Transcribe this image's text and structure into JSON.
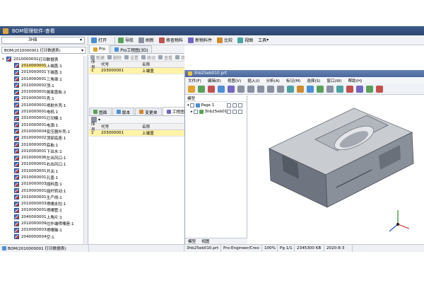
{
  "app": {
    "title": "BOM管理软件-查看",
    "colors": {
      "titlebar": "#34507e",
      "selection": "#ffe98a",
      "highlight_row": "#fff3a8"
    }
  },
  "toolbar": {
    "combo_value": "3HB",
    "items": [
      {
        "label": "打开",
        "icon": "open-icon"
      },
      {
        "label": "导航",
        "icon": "navigate-icon"
      },
      {
        "label": "刷新",
        "icon": "refresh-icon"
      },
      {
        "label": "移查物料",
        "icon": "search-material-icon"
      },
      {
        "label": "新物料件",
        "icon": "new-material-icon"
      },
      {
        "label": "比较",
        "icon": "compare-icon"
      },
      {
        "label": "视图",
        "icon": "view-icon"
      },
      {
        "label": "工具",
        "icon": "tools-icon"
      }
    ]
  },
  "left_panel": {
    "bom_combo": "BOM(2010000001 打印数据表)",
    "tree": [
      {
        "code": "2010000001",
        "name": "打印数据表",
        "root": true
      },
      {
        "code": "2010000001",
        "name": "上端盖:1",
        "selected": true
      },
      {
        "code": "2010000001",
        "name": "下端盖:1"
      },
      {
        "code": "2010000001",
        "name": "三角罩:1"
      },
      {
        "code": "2010000002",
        "name": "顶:1"
      },
      {
        "code": "2010000001",
        "name": "侧面盖板:2"
      },
      {
        "code": "2010000001",
        "name": "壳:1"
      },
      {
        "code": "2010000001",
        "name": "喷射外壳:1"
      },
      {
        "code": "2010000001",
        "name": "电机:1"
      },
      {
        "code": "2010000001",
        "name": "打印模:1"
      },
      {
        "code": "2010000001",
        "name": "电源:1"
      },
      {
        "code": "2010000004",
        "name": "变压器外壳:1"
      },
      {
        "code": "2010000002",
        "name": "顶部底座:1"
      },
      {
        "code": "2010000005",
        "name": "底板:1"
      },
      {
        "code": "2010000001",
        "name": "下出水:1"
      },
      {
        "code": "2010000006",
        "name": "左出风口:1"
      },
      {
        "code": "2010000001",
        "name": "右出风口:1"
      },
      {
        "code": "2010000001",
        "name": "开关:1"
      },
      {
        "code": "2010000001",
        "name": "孔盖:1"
      },
      {
        "code": "2010000003",
        "name": "插料盘:1"
      },
      {
        "code": "2010000001",
        "name": "摇杆转动:1"
      },
      {
        "code": "2010000001",
        "name": "生产线:1"
      },
      {
        "code": "2010000003",
        "name": "喷嘴支柱:1"
      },
      {
        "code": "2010000001",
        "name": "喷嘴管:1"
      },
      {
        "code": "2040000001",
        "name": "上角片:1"
      },
      {
        "code": "2010000009",
        "name": "往外端喷嘴座:1"
      },
      {
        "code": "2010000003",
        "name": "喷嘴轴:1"
      },
      {
        "code": "2040000004",
        "name": "空:1"
      }
    ]
  },
  "mid_panel": {
    "top_tabs": [
      "Pro",
      "Pro工程图(3D)"
    ],
    "top_tools": [
      "新建",
      "删除",
      "设置",
      "移动",
      "查看",
      "移查"
    ],
    "top_headers": [
      "序号",
      "代号",
      "名称",
      ""
    ],
    "top_rows": [
      [
        "1",
        "203000001",
        "上端盖",
        ""
      ]
    ],
    "bottom_tabs": [
      "图面",
      "版本",
      "变更单",
      "工程图"
    ],
    "bottom_headers": [
      "序号",
      "代号",
      "名称",
      ""
    ],
    "bottom_rows": [
      [
        "1",
        "203000001",
        "上端盖",
        ""
      ]
    ]
  },
  "viewer": {
    "title": "3hb25eb010.prt",
    "menu": [
      "文件(F)",
      "编辑(E)",
      "视图(V)",
      "插入(I)",
      "分析(A)",
      "标记(M)",
      "选择(S)",
      "窗口(W)",
      "帮助(H)"
    ],
    "tree_header": "模型",
    "tree_items": [
      {
        "label": "Page 1"
      },
      {
        "label": "3hb25eb010"
      }
    ],
    "bottom_tabs": [
      "模型",
      "视图"
    ]
  },
  "status": {
    "tabs": [
      "BOM(2010000001 打印数据表)"
    ],
    "cells": [
      "3hb25eb010.prt",
      "Pro-Engineer/Creo",
      "100%",
      "Pg 1/1",
      "2345300 KB",
      "2020-8-3"
    ]
  }
}
